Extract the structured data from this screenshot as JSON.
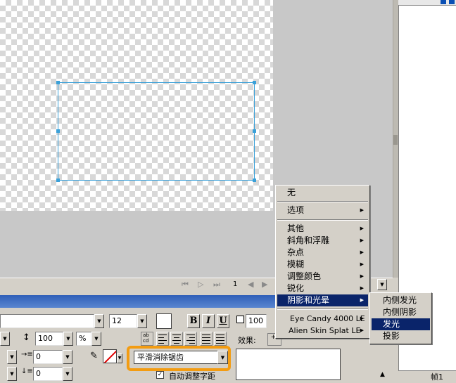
{
  "canvas": {
    "selection_color": "#3aa0d8"
  },
  "statusbar": {
    "page_number": "1",
    "nav_first": "⏮",
    "nav_play": "▷",
    "nav_last": "⏭",
    "nav_prev": "◀",
    "nav_next": "▶"
  },
  "properties": {
    "font_size": "12",
    "bold_label": "B",
    "italic_label": "I",
    "underline_label": "U",
    "leading_value": "100",
    "leading_unit": "%",
    "scale_value": "100",
    "indent_value": "0",
    "space_value": "0",
    "antialias_value": "平滑消除锯齿",
    "effects_label": "效果:",
    "auto_kern_label": "自动调整字距",
    "ab_label": "ab\ncd"
  },
  "effects_menu": {
    "items": [
      {
        "label": "无",
        "submenu": false
      },
      {
        "label": "选项",
        "submenu": true
      },
      {
        "label": "其他",
        "submenu": true
      },
      {
        "label": "斜角和浮雕",
        "submenu": true
      },
      {
        "label": "杂点",
        "submenu": true
      },
      {
        "label": "模糊",
        "submenu": true
      },
      {
        "label": "调整颜色",
        "submenu": true
      },
      {
        "label": "锐化",
        "submenu": true
      },
      {
        "label": "阴影和光晕",
        "submenu": true,
        "selected": true
      },
      {
        "label": "Eye Candy 4000 LE",
        "submenu": true
      },
      {
        "label": "Alien Skin Splat LE",
        "submenu": true
      }
    ]
  },
  "shadow_submenu": {
    "items": [
      {
        "label": "内侧发光"
      },
      {
        "label": "内侧阴影"
      },
      {
        "label": "发光",
        "selected": true
      },
      {
        "label": "投影"
      }
    ]
  },
  "frames_panel": {
    "frame_label": "帧1"
  },
  "colors": {
    "highlight": "#0a246a",
    "accent_orange": "#f39c12",
    "menu_bg": "#d4d0c8"
  }
}
